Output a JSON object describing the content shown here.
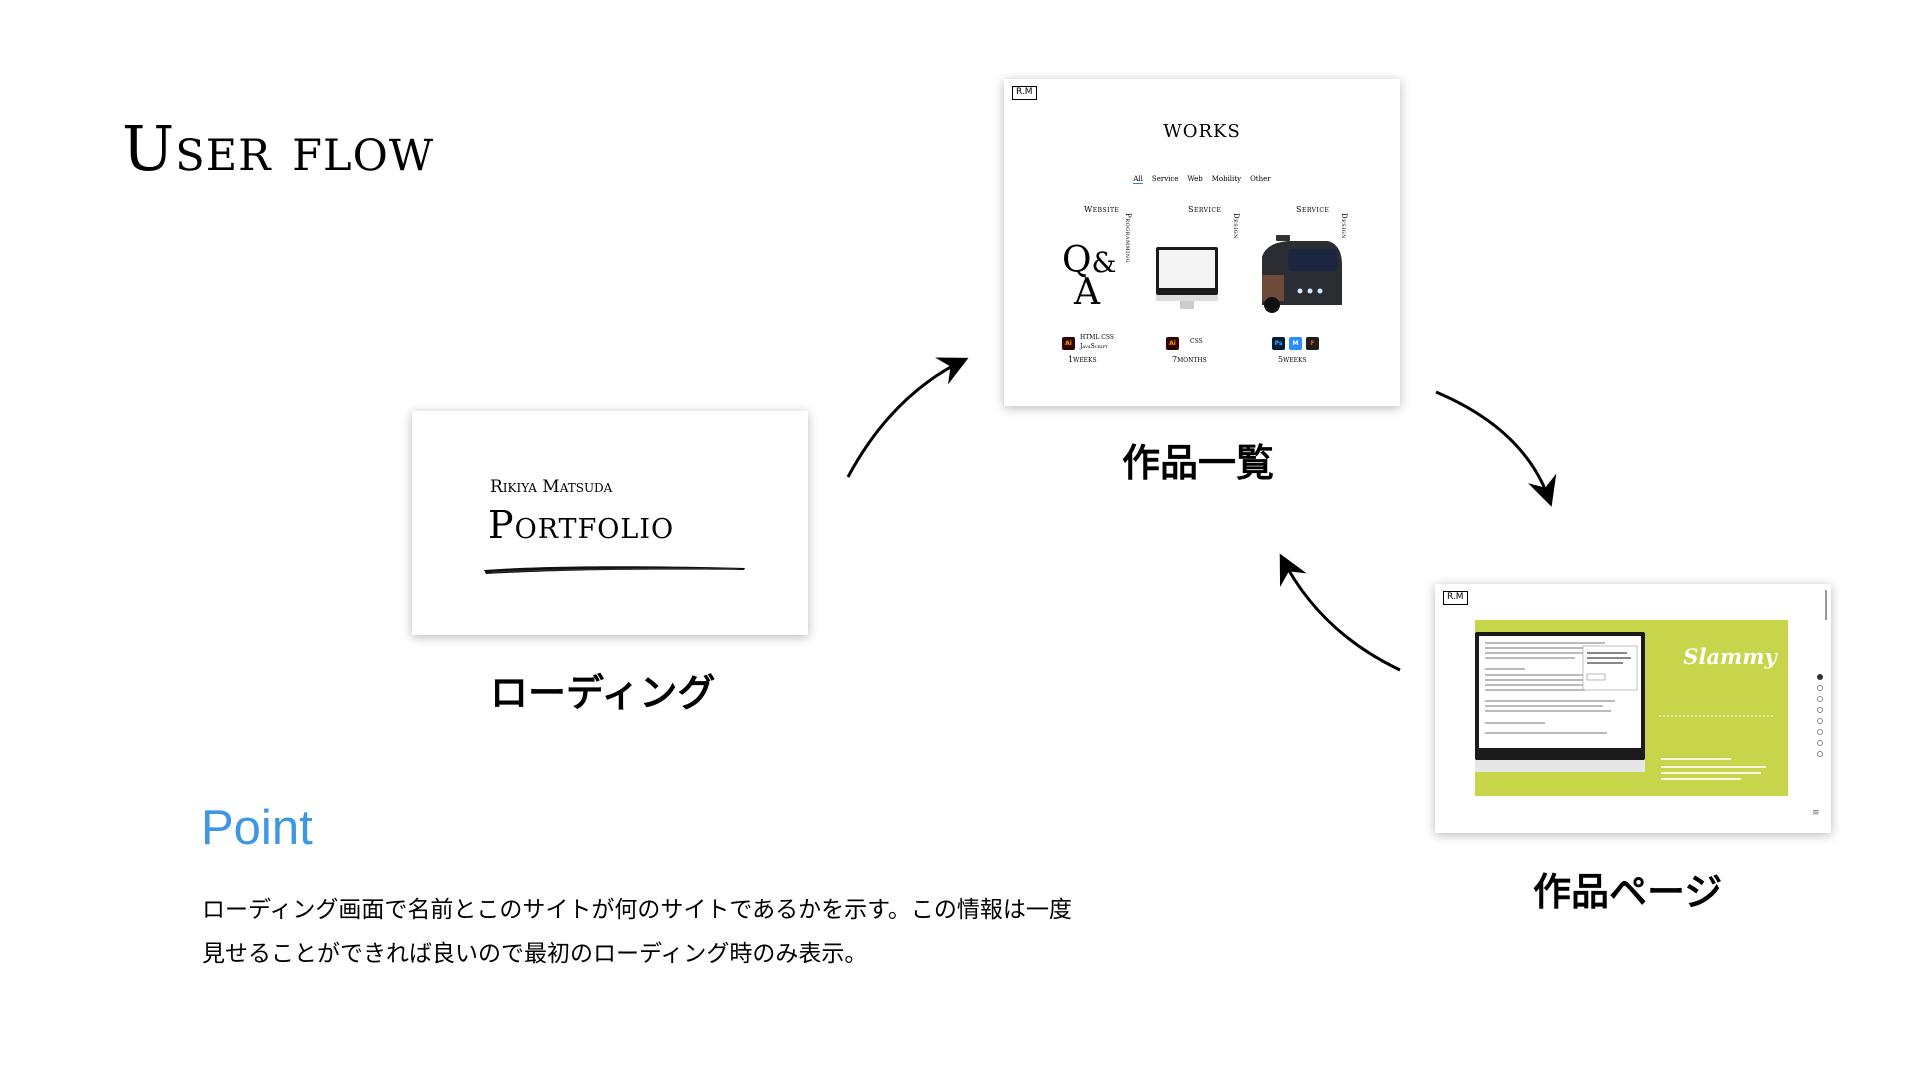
{
  "title": "User flow",
  "loading_card": {
    "name": "Rikiya Matsuda",
    "title": "Portfolio"
  },
  "works_card": {
    "badge": "R.M",
    "heading": "WORKS",
    "filters": [
      "All",
      "Service",
      "Web",
      "Mobility",
      "Other"
    ],
    "columns": [
      {
        "label": "Website",
        "vertical_label": "Programming",
        "tech_lines": [
          "HTML  CSS",
          "JavaScript"
        ],
        "tools": [
          "Ai"
        ],
        "duration": "1weeks"
      },
      {
        "label": "Service",
        "vertical_label": "Design",
        "tech_lines": [
          "CSS"
        ],
        "tools": [
          "Ai"
        ],
        "duration": "7months"
      },
      {
        "label": "Service",
        "vertical_label": "Design",
        "tech_lines": [],
        "tools": [
          "Ps",
          "M",
          "F"
        ],
        "duration": "5weeks"
      }
    ]
  },
  "detail_card": {
    "badge": "R.M",
    "project_name": "Slammy",
    "brand_color": "#c6d54a"
  },
  "captions": {
    "loading": "ローディング",
    "works_list": "作品一覧",
    "work_page": "作品ページ"
  },
  "point": {
    "heading": "Point",
    "line1": "ローディング画面で名前とこのサイトが何のサイトであるかを示す。この情報は一度",
    "line2": "見せることができれば良いので最初のローディング時のみ表示。",
    "accent_color": "#3f97e3"
  }
}
